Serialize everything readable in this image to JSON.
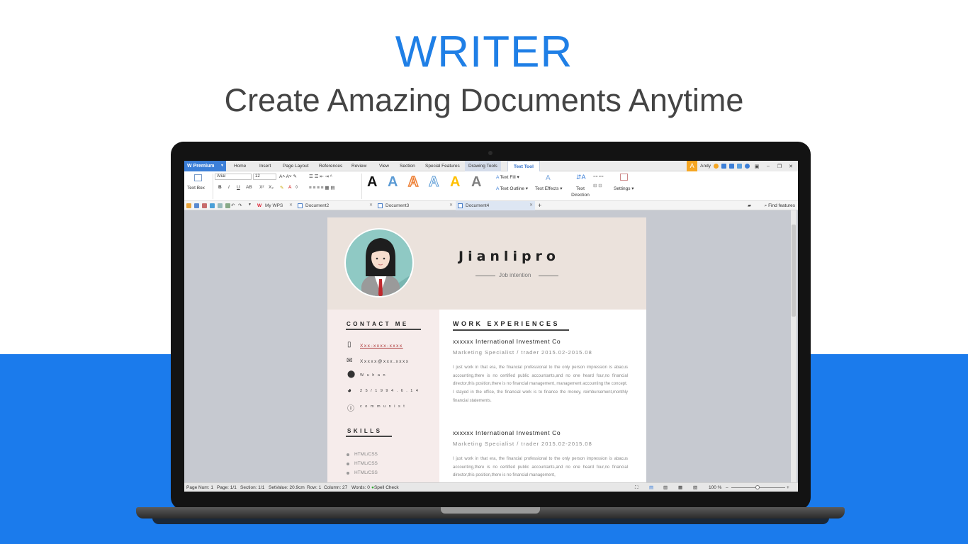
{
  "hero": {
    "title": "WRITER",
    "subtitle": "Create Amazing Documents Anytime"
  },
  "titlebar": {
    "premium_label": "Premium",
    "menus": [
      "Home",
      "Insert",
      "Page Layout",
      "References",
      "Review",
      "View",
      "Section",
      "Special Features"
    ],
    "drawing_tools": "Drawing Tools",
    "text_tool": "Text Tool",
    "user_initial": "A",
    "user_name": "Andy"
  },
  "ribbon": {
    "text_box": "Text Box",
    "font_name": "Arial",
    "font_size": "12",
    "text_fill": "Text Fill",
    "text_outline": "Text Outline",
    "text_effects": "Text Effects",
    "text_direction": "Text Direction",
    "settings": "Settings",
    "style_colors": [
      "#111111",
      "#5b9bd5",
      "#ed7d31",
      "#9dc3e6",
      "#ffc000",
      "#7f7f7f"
    ]
  },
  "doctabs": {
    "tabs": [
      "My WPS",
      "Document2",
      "Document3",
      "Document4"
    ],
    "find_features": "Find features"
  },
  "resume": {
    "name": "Jianlipro",
    "intention": "Job intention",
    "contact_title": "CONTACT ME",
    "phone": "Xxx-xxxx-xxxx",
    "email": "Xxxxx@xxx.xxxx",
    "location": "W u h a n",
    "birthday": "2 5 / 1 9 9 4 . 6 . 1 4",
    "politics": "c o m m u n i s t",
    "skills_title": "SKILLS",
    "skills": [
      "HTML/CSS",
      "HTML/CSS",
      "HTML/CSS"
    ],
    "work_title": "WORK EXPERIENCES",
    "jobs": [
      {
        "company": "xxxxxx International Investment Co",
        "role": "Marketing Specialist / trader 2015.02-2015.08",
        "body": "I just work in that era, the financial professional to the only person impression is abacus accounting,there is no certified public accountants,and no one heard four,no financial director,this position,there is no financial management, management accounting the concept.\nI stayed in the office, the financial work is to finance the money, reimbursement,monthly financial statements."
      },
      {
        "company": "xxxxxx International Investment Co",
        "role": "Marketing Specialist / trader 2015.02-2015.08",
        "body": "I just work in that era, the financial professional to the only person impression is abacus accounting,there is no certified public accountants,and no one heard four,no financial director,this position,there is no financial management,"
      }
    ]
  },
  "status": {
    "page_num": "Page Num: 1",
    "page": "Page: 1/1",
    "section": "Section: 1/1",
    "setvalue": "SetValue: 20.9cm",
    "row": "Row: 1",
    "column": "Column: 27",
    "words": "Words: 0",
    "spell_check": "Spell Check",
    "zoom": "100 %"
  }
}
